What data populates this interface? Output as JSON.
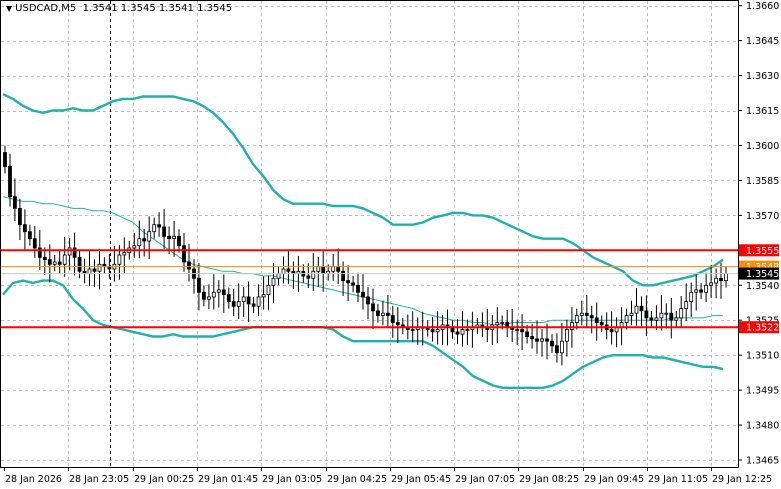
{
  "header": {
    "symbol_tf": "USDCAD,M5",
    "ohlc": "1.3541 1.3545 1.3541 1.3545"
  },
  "colors": {
    "background": "#ffffff",
    "grid": "#c0c0c0",
    "axis": "#000000",
    "candle": "#000000",
    "bollinger": "#20b2aa",
    "level_line": "#ff0000",
    "bid_line": "#ff8c00",
    "bid_label_bg": "#000000",
    "level_label_bg": "#ff0000"
  },
  "chart_data": {
    "type": "candlestick",
    "symbol": "USDCAD",
    "timeframe": "M5",
    "y_ticks": [
      "1.3660",
      "1.3645",
      "1.3630",
      "1.3615",
      "1.3600",
      "1.3585",
      "1.3570",
      "1.3555",
      "1.3540",
      "1.3525",
      "1.3510",
      "1.3495",
      "1.3480",
      "1.3465"
    ],
    "ylim": [
      1.3462,
      1.3662
    ],
    "x_labels": [
      "28 Jan 2026",
      "28 Jan 23:05",
      "29 Jan 00:25",
      "29 Jan 01:45",
      "29 Jan 03:05",
      "29 Jan 04:25",
      "29 Jan 05:45",
      "29 Jan 07:05",
      "29 Jan 08:25",
      "29 Jan 09:45",
      "29 Jan 11:05",
      "29 Jan 12:25"
    ],
    "horizontal_levels": [
      {
        "price": 1.3555,
        "label": "1.3555"
      },
      {
        "price": 1.3522,
        "label": "1.3522"
      }
    ],
    "current_price": {
      "price": 1.3545,
      "label": "1.3545"
    },
    "bid_line": {
      "price": 1.3548,
      "label": "1.3548"
    },
    "grid": true,
    "closes": [
      1.3591,
      1.3578,
      1.3573,
      1.3566,
      1.3563,
      1.356,
      1.3556,
      1.3552,
      1.3551,
      1.3549,
      1.355,
      1.3549,
      1.3553,
      1.3556,
      1.3552,
      1.3546,
      1.3545,
      1.3547,
      1.3546,
      1.3549,
      1.3548,
      1.3547,
      1.3549,
      1.3553,
      1.3554,
      1.3556,
      1.3557,
      1.356,
      1.3559,
      1.3563,
      1.3566,
      1.3565,
      1.3561,
      1.356,
      1.3561,
      1.3557,
      1.355,
      1.3547,
      1.3543,
      1.3537,
      1.3534,
      1.3535,
      1.3537,
      1.3538,
      1.3536,
      1.3533,
      1.3531,
      1.3533,
      1.3535,
      1.3532,
      1.3531,
      1.3535,
      1.3536,
      1.354,
      1.3543,
      1.3545,
      1.3547,
      1.3546,
      1.3545,
      1.3546,
      1.3544,
      1.3543,
      1.3546,
      1.3548,
      1.3545,
      1.3546,
      1.3548,
      1.3546,
      1.3542,
      1.3541,
      1.354,
      1.3537,
      1.3535,
      1.3532,
      1.3529,
      1.3527,
      1.3528,
      1.3527,
      1.3524,
      1.3523,
      1.3522,
      1.3521,
      1.3521,
      1.3522,
      1.3522,
      1.3521,
      1.352,
      1.3521,
      1.3523,
      1.3522,
      1.352,
      1.3519,
      1.3521,
      1.3521,
      1.3522,
      1.3523,
      1.3522,
      1.3521,
      1.3523,
      1.3524,
      1.3524,
      1.3522,
      1.3521,
      1.3521,
      1.352,
      1.3518,
      1.3517,
      1.3516,
      1.3517,
      1.3516,
      1.3514,
      1.3511,
      1.3516,
      1.3521,
      1.3524,
      1.3527,
      1.3528,
      1.3527,
      1.3526,
      1.3524,
      1.3523,
      1.3521,
      1.352,
      1.3522,
      1.3524,
      1.3527,
      1.3528,
      1.3531,
      1.3529,
      1.3526,
      1.3525,
      1.3526,
      1.3528,
      1.3528,
      1.3525,
      1.3526,
      1.353,
      1.3533,
      1.3537,
      1.3538,
      1.3537,
      1.354,
      1.3541,
      1.3543,
      1.3542,
      1.3545
    ],
    "bollinger_upper": [
      1.3622,
      1.362,
      1.3617,
      1.3615,
      1.3614,
      1.3615,
      1.3615,
      1.3616,
      1.3615,
      1.3615,
      1.3617,
      1.3619,
      1.362,
      1.362,
      1.3621,
      1.3621,
      1.3621,
      1.3621,
      1.362,
      1.3619,
      1.3617,
      1.3614,
      1.361,
      1.3605,
      1.3599,
      1.3592,
      1.3587,
      1.3581,
      1.3577,
      1.3575,
      1.3575,
      1.3575,
      1.3575,
      1.3574,
      1.3574,
      1.3574,
      1.3573,
      1.3571,
      1.3569,
      1.3566,
      1.3566,
      1.3566,
      1.3567,
      1.3569,
      1.357,
      1.3571,
      1.3571,
      1.357,
      1.357,
      1.3569,
      1.3567,
      1.3565,
      1.3563,
      1.3561,
      1.356,
      1.356,
      1.356,
      1.3558,
      1.3555,
      1.3552,
      1.355,
      1.3548,
      1.3546,
      1.3542,
      1.354,
      1.354,
      1.3541,
      1.3542,
      1.3543,
      1.3544,
      1.3546,
      1.3548,
      1.3551
    ],
    "bollinger_middle": [
      1.3578,
      1.3577,
      1.3576,
      1.3576,
      1.3575,
      1.3575,
      1.3574,
      1.3573,
      1.3573,
      1.3572,
      1.3572,
      1.3571,
      1.3569,
      1.3567,
      1.3563,
      1.356,
      1.3557,
      1.3554,
      1.3551,
      1.3549,
      1.3548,
      1.3547,
      1.3546,
      1.3546,
      1.3545,
      1.3545,
      1.3544,
      1.3544,
      1.3543,
      1.3542,
      1.3541,
      1.354,
      1.3539,
      1.3538,
      1.3537,
      1.3536,
      1.3535,
      1.3534,
      1.3533,
      1.3532,
      1.3531,
      1.353,
      1.3528,
      1.3527,
      1.3526,
      1.3525,
      1.3525,
      1.3524,
      1.3524,
      1.3523,
      1.3523,
      1.3524,
      1.3524,
      1.3524,
      1.3524,
      1.3525,
      1.3525,
      1.3525,
      1.3525,
      1.3525,
      1.3525,
      1.3525,
      1.3525,
      1.3525,
      1.3525,
      1.3525,
      1.3525,
      1.3526,
      1.3526,
      1.3526,
      1.3526,
      1.3527,
      1.3527
    ],
    "bollinger_lower": [
      1.3536,
      1.3541,
      1.3542,
      1.3541,
      1.3542,
      1.3542,
      1.354,
      1.3534,
      1.353,
      1.3525,
      1.3523,
      1.3522,
      1.3521,
      1.352,
      1.3519,
      1.3518,
      1.3518,
      1.3519,
      1.3518,
      1.3518,
      1.3518,
      1.3518,
      1.3519,
      1.352,
      1.3521,
      1.3522,
      1.3522,
      1.3522,
      1.3522,
      1.3522,
      1.3522,
      1.3522,
      1.3522,
      1.3521,
      1.3518,
      1.3516,
      1.3516,
      1.3516,
      1.3516,
      1.3516,
      1.3516,
      1.3516,
      1.3516,
      1.3514,
      1.3511,
      1.3508,
      1.3505,
      1.3501,
      1.3499,
      1.3497,
      1.3496,
      1.3496,
      1.3496,
      1.3496,
      1.3496,
      1.3497,
      1.3499,
      1.3502,
      1.3505,
      1.3507,
      1.3509,
      1.351,
      1.351,
      1.351,
      1.351,
      1.3509,
      1.3509,
      1.3508,
      1.3507,
      1.3506,
      1.3505,
      1.3505,
      1.3504
    ]
  }
}
